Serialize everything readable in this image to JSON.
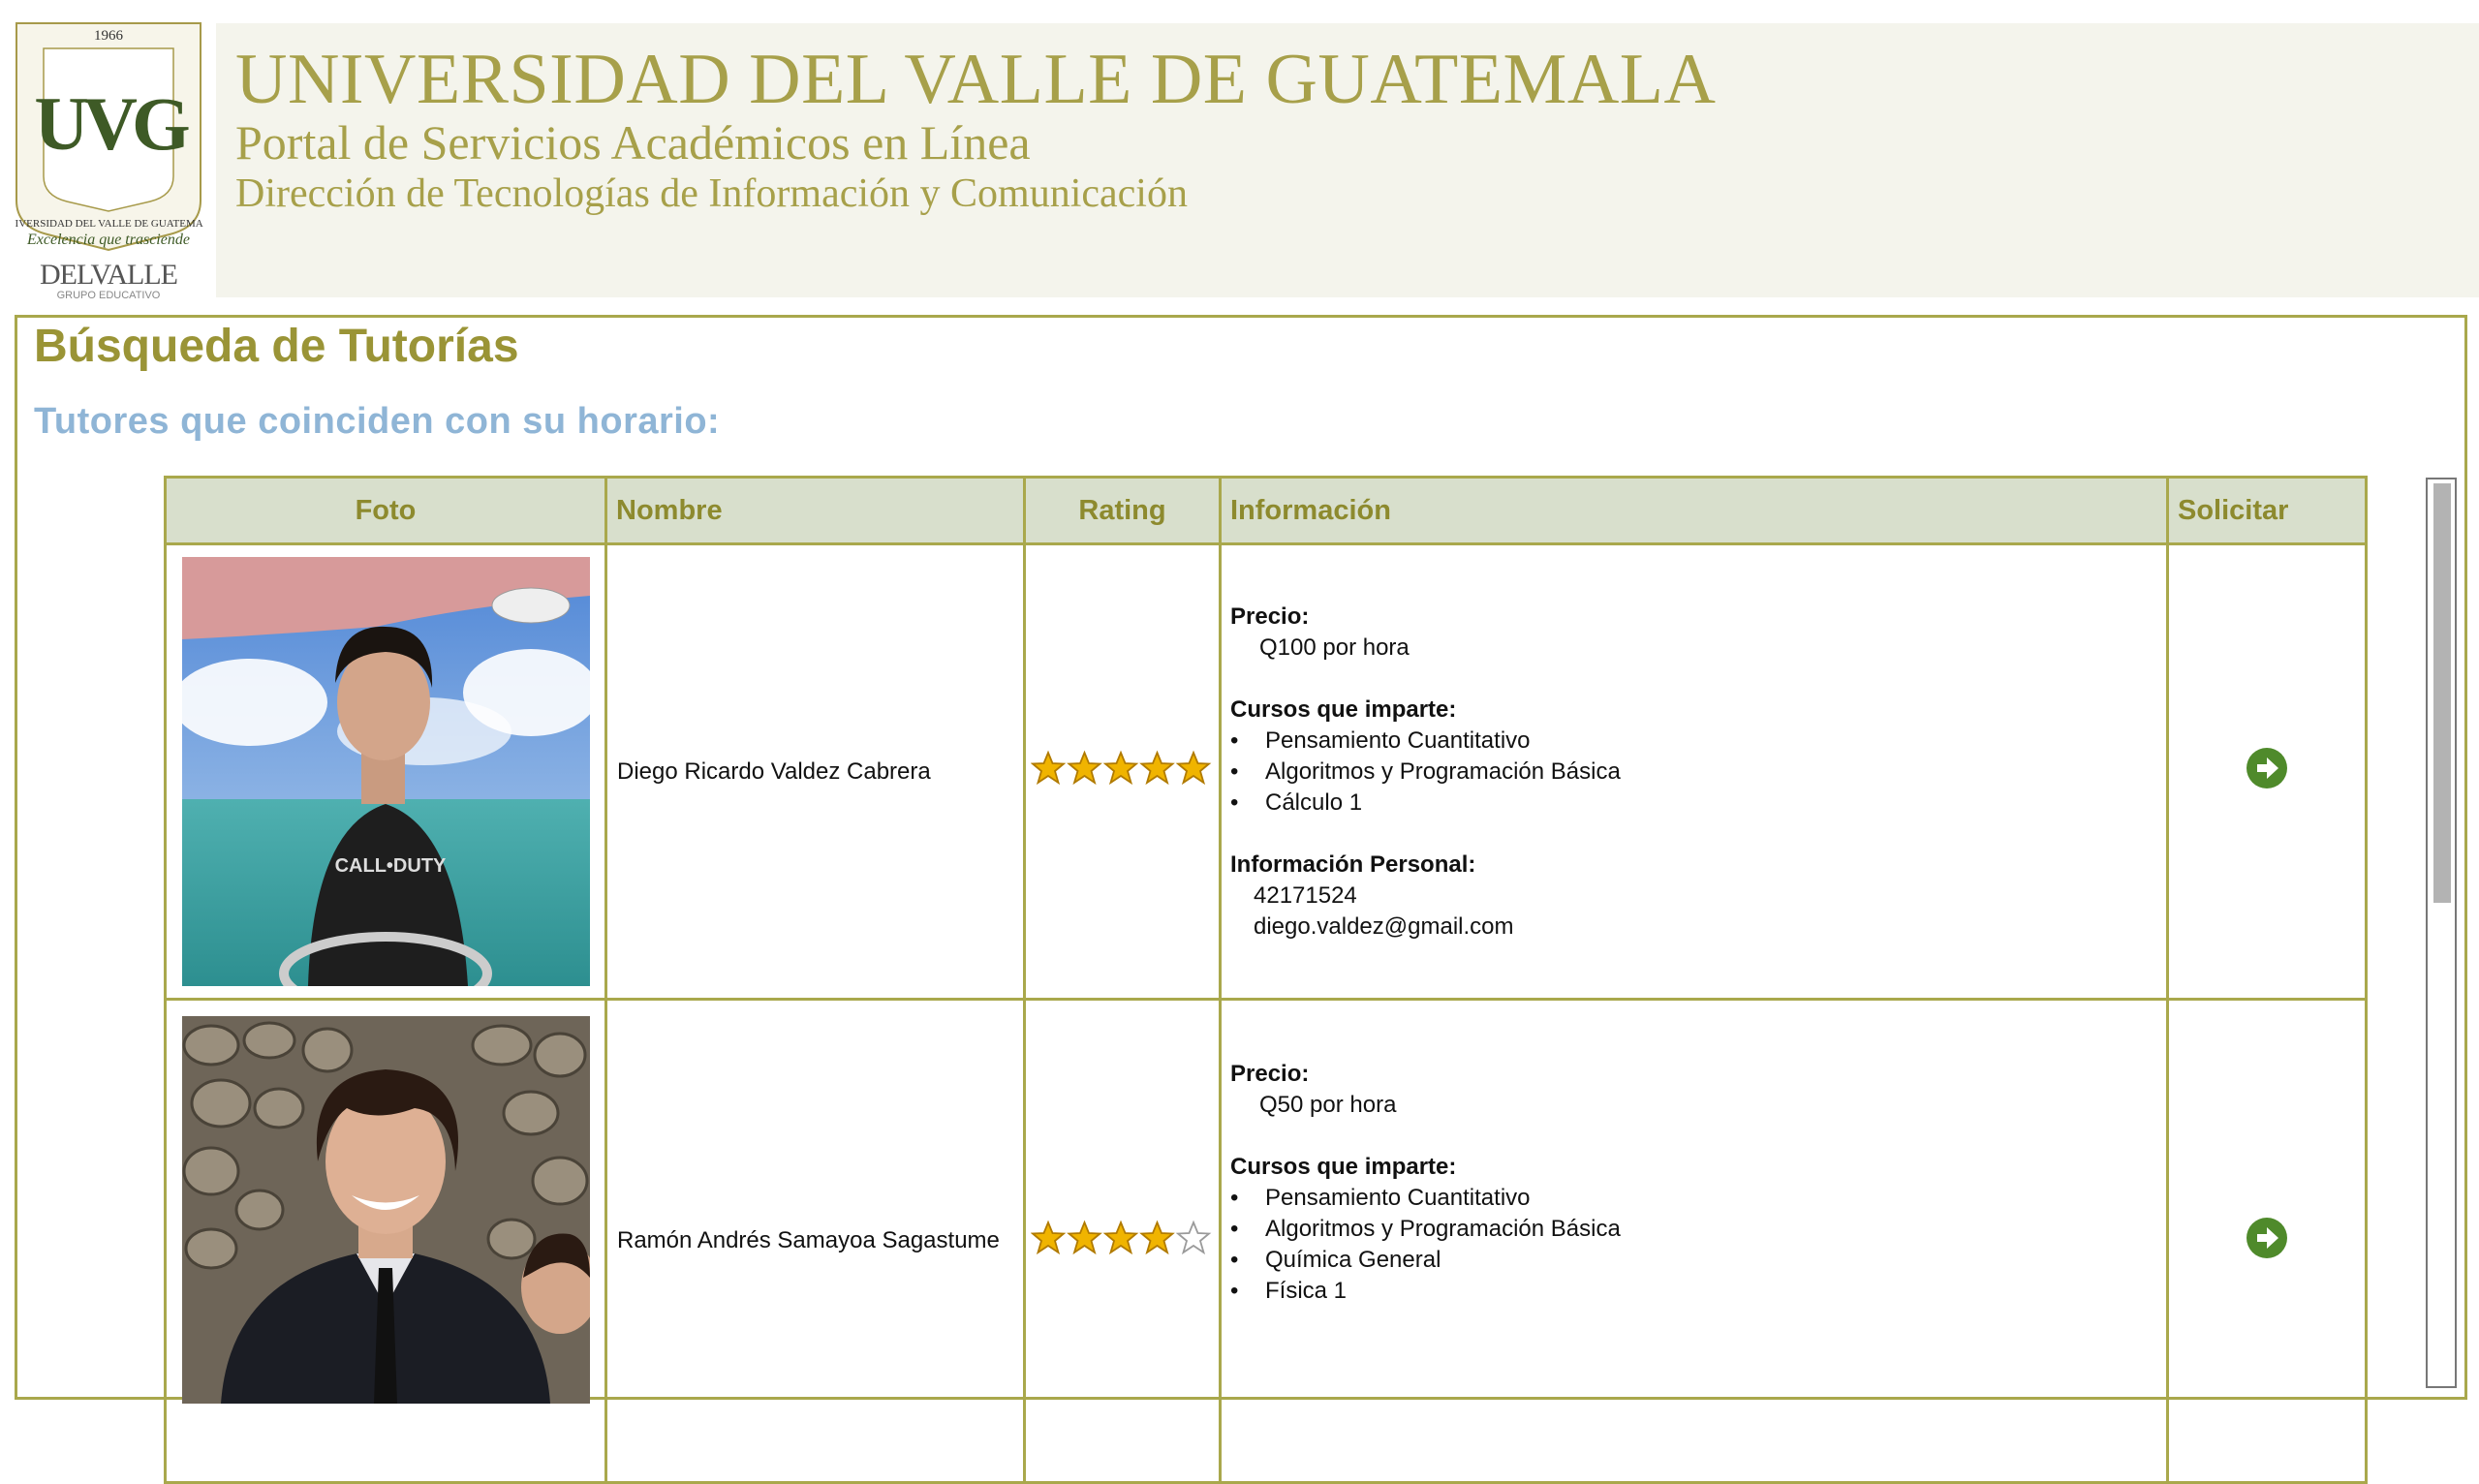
{
  "header": {
    "title": "UNIVERSIDAD DEL VALLE DE GUATEMALA",
    "subtitle": "Portal de Servicios Académicos en Línea",
    "department": "Dirección de Tecnologías de Información y Comunicación"
  },
  "logo": {
    "year": "1966",
    "monogram": "UVG",
    "ring_text": "UNIVERSIDAD DEL VALLE DE GUATEMALA",
    "motto": "Excelencia que trasciende",
    "group_name": "DELVALLE",
    "group_sub": "GRUPO EDUCATIVO"
  },
  "page": {
    "title": "Búsqueda de Tutorías",
    "subtitle": "Tutores que coinciden con su horario:"
  },
  "table": {
    "headers": {
      "photo": "Foto",
      "name": "Nombre",
      "rating": "Rating",
      "info": "Información",
      "request": "Solicitar"
    },
    "labels": {
      "price": "Precio:",
      "courses": "Cursos que imparte:",
      "personal": "Información Personal:"
    },
    "rows": [
      {
        "name": "Diego Ricardo Valdez Cabrera",
        "rating": 5,
        "price": "Q100 por hora",
        "courses": [
          "Pensamiento Cuantitativo",
          "Algoritmos y Programación Básica",
          "Cálculo 1"
        ],
        "phone": "42171524",
        "email": "diego.valdez@gmail.com",
        "shirt_text": "CALL•DUTY"
      },
      {
        "name": "Ramón Andrés Samayoa Sagastume",
        "rating": 4,
        "price": "Q50 por hora",
        "courses": [
          "Pensamiento Cuantitativo",
          "Algoritmos y Programación Básica",
          "Química General",
          "Física 1"
        ]
      }
    ]
  },
  "scrollbar": {
    "position": 0.0,
    "visible_fraction": 0.46
  },
  "colors": {
    "accent_olive": "#a7a04a",
    "header_band": "#f4f4ec",
    "table_header": "#d8dfcc",
    "subtitle_blue": "#8fb5d6",
    "button_green": "#4f8a2b",
    "star_gold": "#f0b400"
  }
}
